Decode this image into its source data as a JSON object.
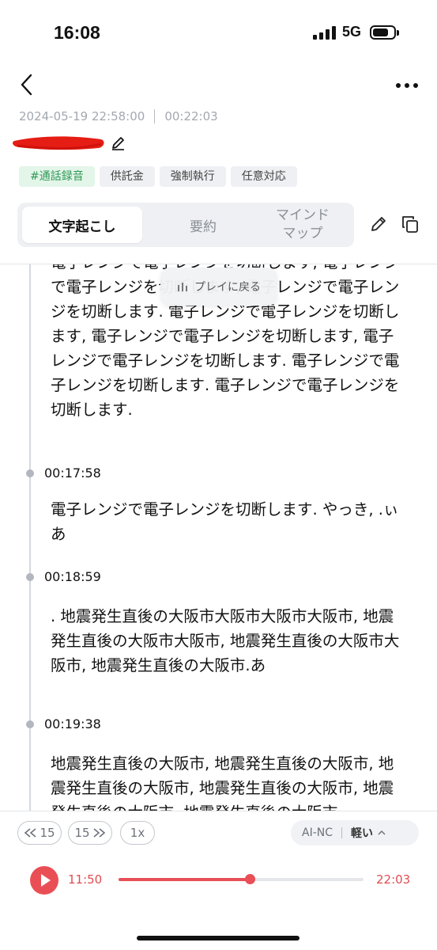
{
  "status_bar": {
    "time": "16:08",
    "network": "5G"
  },
  "header": {
    "datetime": "2024-05-19 22:58:00",
    "duration": "00:22:03",
    "icons": {
      "back": "chevron-left-icon",
      "more": "more-horizontal-icon",
      "title_edit": "pencil-icon"
    }
  },
  "tags": [
    "#通話録音",
    "供託金",
    "強制執行",
    "任意対応"
  ],
  "tabs": {
    "items": [
      "文字起こし",
      "要約",
      "マインドマップ"
    ],
    "active": 0,
    "mindmap_line1": "マインド",
    "mindmap_line2": "マップ",
    "icons": {
      "edit": "pencil-icon",
      "copy": "copy-icon"
    }
  },
  "play_back_label": "プレイに戻る",
  "transcript": {
    "first_para": "電子レンジで電子レンジを切断します, 電子レンジで電子レンジを切断します, 電子レンジで電子レンジを切断します. 電子レンジで電子レンジを切断します, 電子レンジで電子レンジを切断します, 電子レンジで電子レンジを切断します. 電子レンジで電子レンジを切断します. 電子レンジで電子レンジを切断します.",
    "segments": [
      {
        "time": "00:17:58",
        "text": "電子レンジで電子レンジを切断します. やっき, .ぃ あ"
      },
      {
        "time": "00:18:59",
        "text": ". 地震発生直後の大阪市大阪市大阪市大阪市, 地震発生直後の大阪市大阪市, 地震発生直後の大阪市大阪市, 地震発生直後の大阪市.あ"
      },
      {
        "time": "00:19:38",
        "text": "地震発生直後の大阪市, 地震発生直後の大阪市, 地震発生直後の大阪市, 地震発生直後の大阪市, 地震発生直後の大阪市, 地震発生直後の大阪市"
      }
    ]
  },
  "controls": {
    "rewind": "15",
    "forward": "15",
    "speed": "1x",
    "noise_label": "AI-NC",
    "noise_mode": "軽い"
  },
  "player": {
    "current": "11:50",
    "total": "22:03",
    "progress": 0.537
  },
  "colors": {
    "accent": "#e84f57",
    "tag_green": "#2f9a55"
  }
}
